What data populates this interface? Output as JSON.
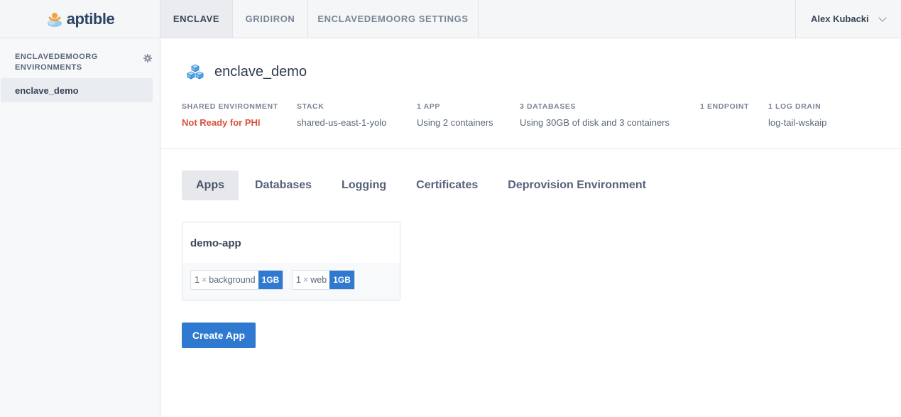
{
  "brand": {
    "name": "aptible"
  },
  "nav": {
    "tabs": [
      {
        "label": "ENCLAVE",
        "active": true
      },
      {
        "label": "GRIDIRON",
        "active": false
      },
      {
        "label": "ENCLAVEDEMOORG SETTINGS",
        "active": false
      }
    ],
    "user": "Alex Kubacki"
  },
  "sidebar": {
    "heading": "ENCLAVEDEMOORG ENVIRONMENTS",
    "items": [
      {
        "label": "enclave_demo",
        "selected": true
      }
    ]
  },
  "environment": {
    "name": "enclave_demo",
    "stats": [
      {
        "label": "SHARED ENVIRONMENT",
        "value": "Not Ready for PHI",
        "status": "danger"
      },
      {
        "label": "STACK",
        "value": "shared-us-east-1-yolo"
      },
      {
        "label": "1 APP",
        "value": "Using 2 containers"
      },
      {
        "label": "3 DATABASES",
        "value": "Using 30GB of disk and 3 containers"
      },
      {
        "label": "1 ENDPOINT",
        "value": ""
      },
      {
        "label": "1 LOG DRAIN",
        "value": "log-tail-wskaip"
      }
    ]
  },
  "tabs": [
    {
      "label": "Apps",
      "active": true
    },
    {
      "label": "Databases",
      "active": false
    },
    {
      "label": "Logging",
      "active": false
    },
    {
      "label": "Certificates",
      "active": false
    },
    {
      "label": "Deprovision Environment",
      "active": false
    }
  ],
  "apps": [
    {
      "name": "demo-app",
      "services": [
        {
          "count": "1",
          "times": "×",
          "name": "background",
          "size": "1GB"
        },
        {
          "count": "1",
          "times": "×",
          "name": "web",
          "size": "1GB"
        }
      ]
    }
  ],
  "actions": {
    "create_app": "Create App"
  },
  "colors": {
    "primary": "#2f7ad0",
    "danger": "#d9503f",
    "brand": "#2d4466",
    "logo_accent": "#f0a342"
  },
  "icons": {
    "logo": "aptible-logo-icon",
    "gear": "gear-icon",
    "environment": "cubes-icon",
    "user_menu": "chevron-down-icon"
  }
}
